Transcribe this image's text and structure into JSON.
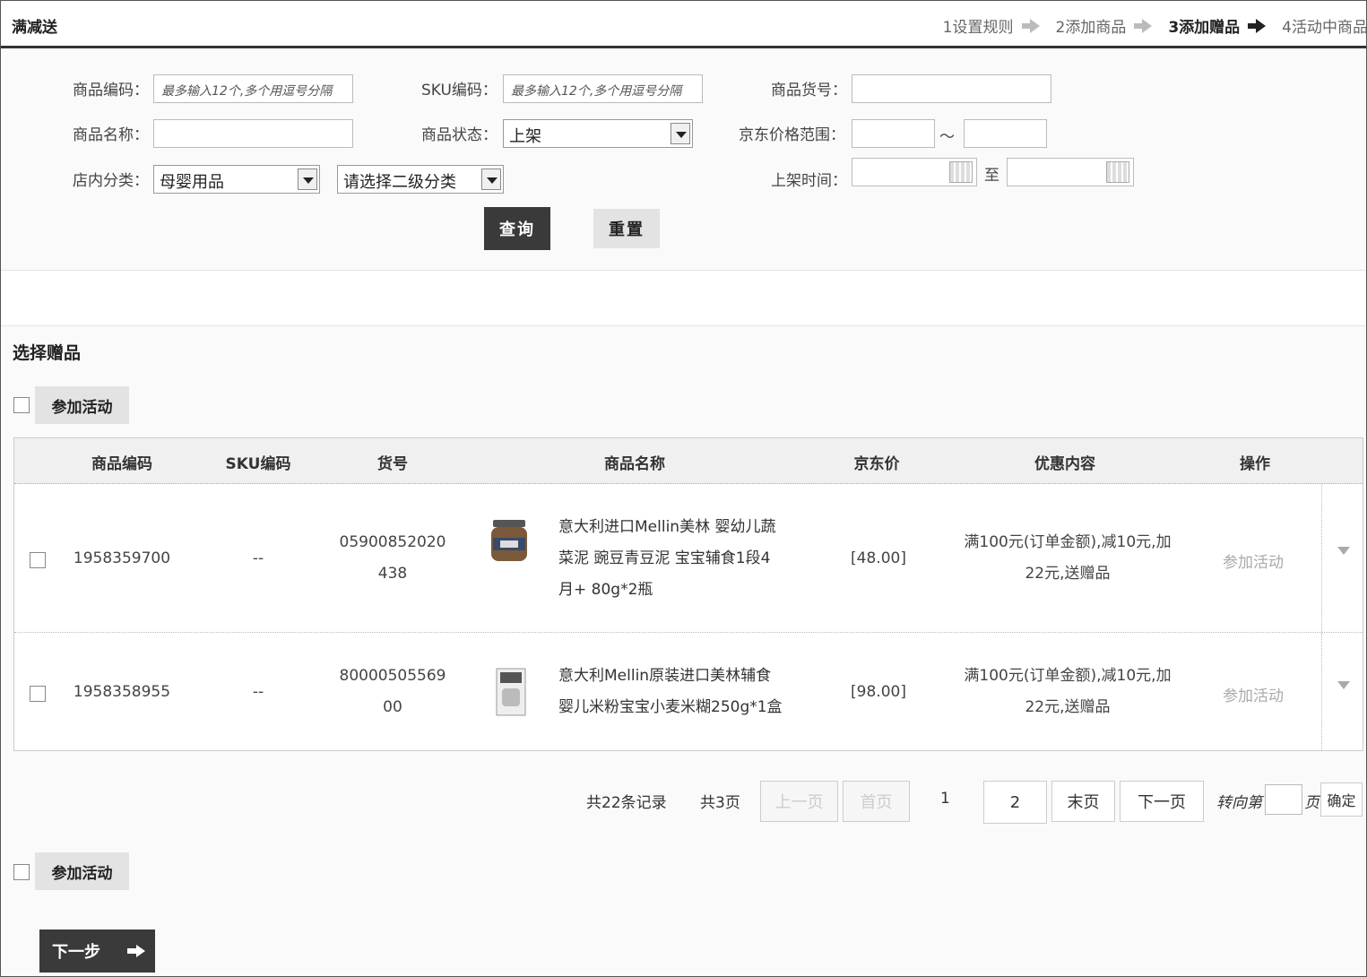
{
  "header": {
    "title": "满减送",
    "steps": [
      "1设置规则",
      "2添加商品",
      "3添加赠品",
      "4活动中商品"
    ],
    "active_step_index": 2
  },
  "filters": {
    "product_code_label": "商品编码：",
    "product_code_placeholder": "最多输入12个,多个用逗号分隔",
    "sku_label": "SKU编码：",
    "sku_placeholder": "最多输入12个,多个用逗号分隔",
    "item_no_label": "商品货号：",
    "product_name_label": "商品名称：",
    "status_label": "商品状态：",
    "status_value": "上架",
    "price_range_label": "京东价格范围：",
    "price_range_sep": "～",
    "category_label": "店内分类：",
    "category_value": "母婴用品",
    "subcategory_value": "请选择二级分类",
    "shelf_time_label": "上架时间：",
    "shelf_time_sep": "至",
    "query_button": "查询",
    "reset_button": "重置"
  },
  "gift_section": {
    "title": "选择赠品",
    "join_button": "参加活动",
    "columns": [
      "商品编码",
      "SKU编码",
      "货号",
      "商品名称",
      "京东价",
      "优惠内容",
      "操作"
    ],
    "rows": [
      {
        "code": "1958359700",
        "sku": "--",
        "item_no_line1": "05900852020",
        "item_no_line2": "438",
        "name_line1": "意大利进口Mellin美林 婴幼儿蔬",
        "name_line2": "菜泥 豌豆青豆泥 宝宝辅食1段4",
        "name_line3": "月+ 80g*2瓶",
        "price": "[48.00]",
        "promo_line1": "满100元(订单金额),减10元,加",
        "promo_line2": "22元,送赠品",
        "action": "参加活动"
      },
      {
        "code": "1958358955",
        "sku": "--",
        "item_no_line1": "80000505569",
        "item_no_line2": "00",
        "name_line1": "意大利Mellin原装进口美林辅食",
        "name_line2": "婴儿米粉宝宝小麦米糊250g*1盒",
        "price": "[98.00]",
        "promo_line1": "满100元(订单金额),减10元,加",
        "promo_line2": "22元,送赠品",
        "action": "参加活动"
      }
    ]
  },
  "pagination": {
    "total_records": "共22条记录",
    "total_pages": "共3页",
    "prev": "上一页",
    "first": "首页",
    "page1": "1",
    "page2": "2",
    "last": "末页",
    "next": "下一页",
    "goto_label": "转向第",
    "goto_suffix": "页",
    "confirm": "确定"
  },
  "footer": {
    "join_button": "参加活动",
    "next_step": "下一步"
  },
  "colors": {
    "dark_button": "#3a3a3a",
    "light_button": "#e3e3e3",
    "header_rule": "#333333"
  }
}
